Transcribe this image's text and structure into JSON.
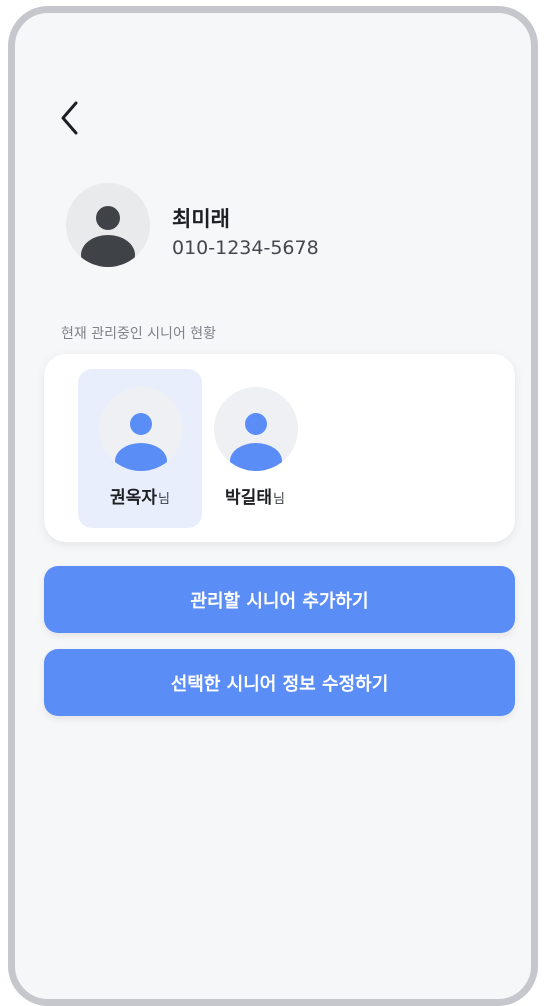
{
  "header": {
    "back_icon": "chevron-left-icon"
  },
  "profile": {
    "name": "최미래",
    "phone": "010-1234-5678",
    "avatar_icon": "person-icon"
  },
  "seniors_section": {
    "title": "현재 관리중인 시니어 현황",
    "suffix": "님",
    "selected_index": 0,
    "items": [
      {
        "name": "권옥자",
        "suffix": "님",
        "selected": true
      },
      {
        "name": "박길태",
        "suffix": "님",
        "selected": false
      }
    ]
  },
  "actions": {
    "add_label": "관리할 시니어 추가하기",
    "edit_label": "선택한 시니어 정보 수정하기"
  },
  "colors": {
    "accent": "#5b8df7",
    "selected_bg": "#e8eefc",
    "avatar_dark": "#3f4247",
    "avatar_blue": "#5b8df7",
    "background": "#f6f7f9"
  }
}
